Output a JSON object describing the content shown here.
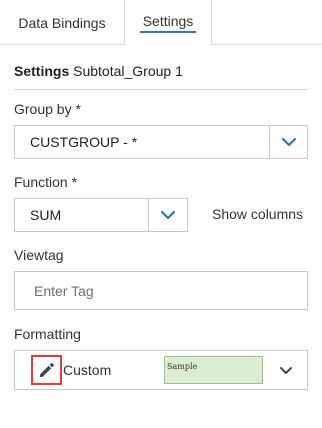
{
  "tabs": {
    "data_bindings": "Data Bindings",
    "settings": "Settings"
  },
  "header": {
    "title": "Settings",
    "name": "Subtotal_Group 1"
  },
  "group_by": {
    "label": "Group by *",
    "value": "CUSTGROUP - *"
  },
  "function": {
    "label": "Function *",
    "value": "SUM",
    "show_columns": "Show columns"
  },
  "viewtag": {
    "label": "Viewtag",
    "placeholder": "Enter Tag",
    "value": ""
  },
  "formatting": {
    "label": "Formatting",
    "name": "Custom",
    "sample": "Sample"
  },
  "icons": {
    "dropdown": "chevron-down-icon",
    "edit": "pencil-icon"
  },
  "colors": {
    "accent": "#2a79b8",
    "edit_highlight": "#e23b3b",
    "sample_bg": "#dbecd2"
  }
}
